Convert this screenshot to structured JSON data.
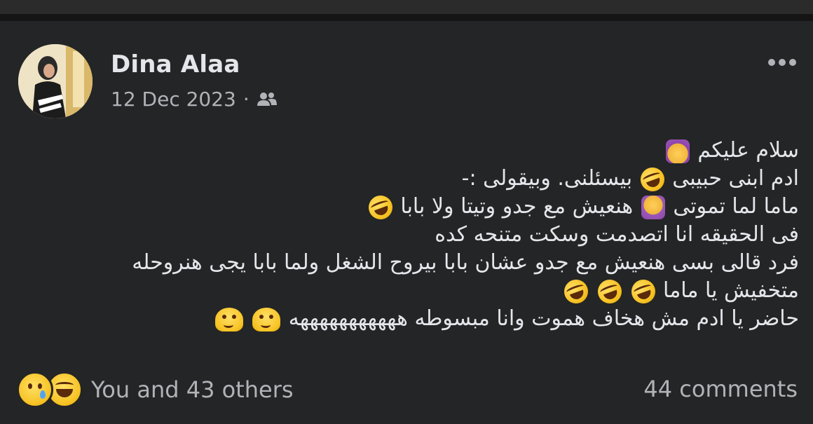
{
  "post": {
    "author": "Dina Alaa",
    "date": "12 Dec 2023",
    "separator": "·",
    "audience_icon": "friends-icon",
    "more_icon": "more-options-icon",
    "lines": [
      {
        "text": "سلام عليكم",
        "emoji": [
          "raising-hand-emoji"
        ]
      },
      {
        "text_before": "ادم ابنى حبيبى",
        "text_after": "بيسئلنى. وبيقولى :-",
        "emoji": [
          "rolling-laughing-emoji"
        ]
      },
      {
        "text_before": "ماما لما تموتى",
        "text_after": "هنعيش مع جدو وتيتا ولا بابا",
        "emoji": [
          "no-gesture-emoji",
          "rolling-laughing-emoji"
        ]
      },
      {
        "text": "فى الحقيقه انا اتصدمت  وسكت متنحه كده"
      },
      {
        "text": "فرد قالى بسى هنعيش مع جدو عشان بابا  بيروح الشغل ولما بابا يجى هنروحله"
      },
      {
        "text": "متخفيش يا ماما",
        "emoji": [
          "rolling-laughing-emoji",
          "rolling-laughing-emoji",
          "rolling-laughing-emoji"
        ]
      },
      {
        "text": "حاضر يا ادم مش هخاف هموت وانا مبسوطه هههههههههههه",
        "emoji": [
          "melting-face-emoji",
          "melting-face-emoji"
        ]
      }
    ]
  },
  "footer": {
    "reaction_icons": [
      "sad-reaction-icon",
      "haha-reaction-icon"
    ],
    "reactions_text": "You and 43 others",
    "comments_text": "44 comments"
  },
  "colors": {
    "background": "#242526",
    "primary_text": "#e4e6eb",
    "secondary_text": "#b0b3b8"
  }
}
